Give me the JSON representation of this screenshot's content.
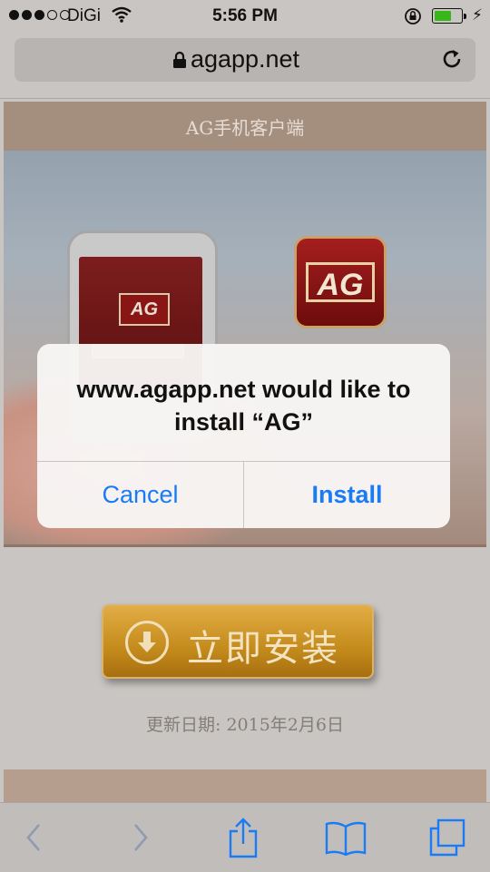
{
  "status_bar": {
    "carrier": "DiGi",
    "time": "5:56 PM",
    "battery_level": 0.65,
    "colors": {
      "battery": "#38b71a"
    }
  },
  "url_bar": {
    "url": "agapp.net",
    "icons": [
      "lock-icon",
      "reload-icon"
    ]
  },
  "page": {
    "banner_title": "AG手机客户端",
    "logo_text": "AG",
    "install_button_label": "立即安装",
    "update_date": "更新日期:   2015年2月6日"
  },
  "alert": {
    "message": "www.agapp.net would like to install “AG”",
    "cancel_label": "Cancel",
    "install_label": "Install",
    "button_color": "#1a7cf5"
  },
  "toolbar": {
    "icons": [
      "back-icon",
      "forward-icon",
      "share-icon",
      "bookmarks-icon",
      "tabs-icon"
    ],
    "icon_color": "#1a7cf5"
  }
}
